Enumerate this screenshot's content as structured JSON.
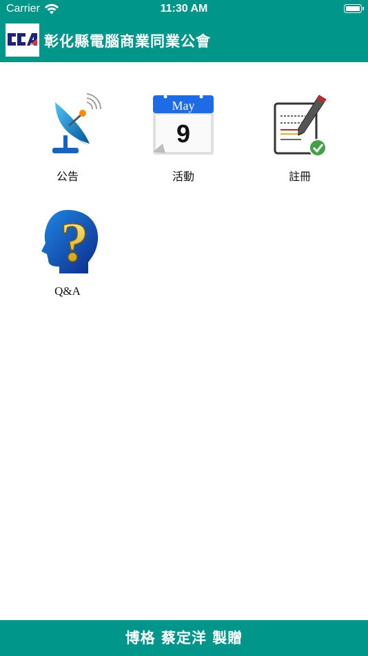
{
  "status_bar": {
    "carrier": "Carrier",
    "time": "11:30 AM"
  },
  "header": {
    "logo": "cca-logo",
    "title": "彰化縣電腦商業同業公會"
  },
  "menu": [
    {
      "label": "公告",
      "icon": "satellite-dish-icon"
    },
    {
      "label": "活動",
      "icon": "calendar-icon",
      "calendar_month": "May",
      "calendar_day": "9"
    },
    {
      "label": "註冊",
      "icon": "register-checklist-icon"
    },
    {
      "label": "Q&A",
      "icon": "question-head-icon"
    }
  ],
  "footer": {
    "text": "博格 蔡定洋 製贈"
  },
  "colors": {
    "primary": "#00968a",
    "background": "#ffffff"
  }
}
